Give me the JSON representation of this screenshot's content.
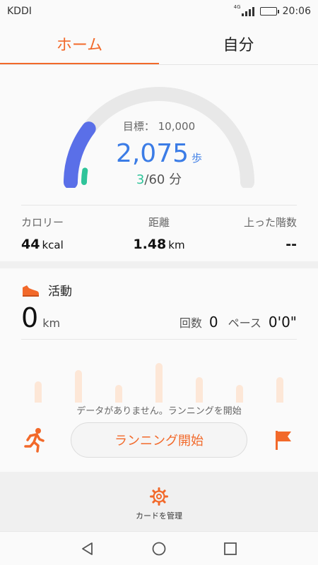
{
  "status_bar": {
    "carrier": "KDDI",
    "network": "4G",
    "time": "20:06"
  },
  "tabs": [
    {
      "label": "ホーム",
      "active": true
    },
    {
      "label": "自分",
      "active": false
    }
  ],
  "summary": {
    "goal_label": "目標： 10,000",
    "steps": "2,075",
    "steps_unit": "歩",
    "active_minutes": "3",
    "minutes_suffix": "/60 分",
    "step_progress_fraction": 0.2075,
    "minutes_progress_fraction": 0.05
  },
  "stats": [
    {
      "label": "カロリー",
      "value": "44",
      "unit": "kcal"
    },
    {
      "label": "距離",
      "value": "1.48",
      "unit": "km"
    },
    {
      "label": "上った階数",
      "value": "--",
      "unit": ""
    }
  ],
  "activity": {
    "title": "活動",
    "distance": "0",
    "distance_unit": "km",
    "count_label": "回数",
    "count": "0",
    "pace_label": "ペース",
    "pace": "0'0\"",
    "no_data": "データがありません。ランニングを開始",
    "run_button": "ランニング開始"
  },
  "manage": {
    "label": "カードを管理"
  },
  "colors": {
    "accent": "#f2692a",
    "steps_blue": "#3b7ce6",
    "gauge_blue": "#5a6fe8",
    "active_green": "#2fc49a",
    "bar_placeholder": "#fde7d7"
  },
  "icons": {
    "activity": "shoe-icon",
    "run": "runner-icon",
    "flag": "flag-icon",
    "manage": "gear-icon",
    "nav": [
      "back-icon",
      "home-icon",
      "recents-icon"
    ]
  }
}
